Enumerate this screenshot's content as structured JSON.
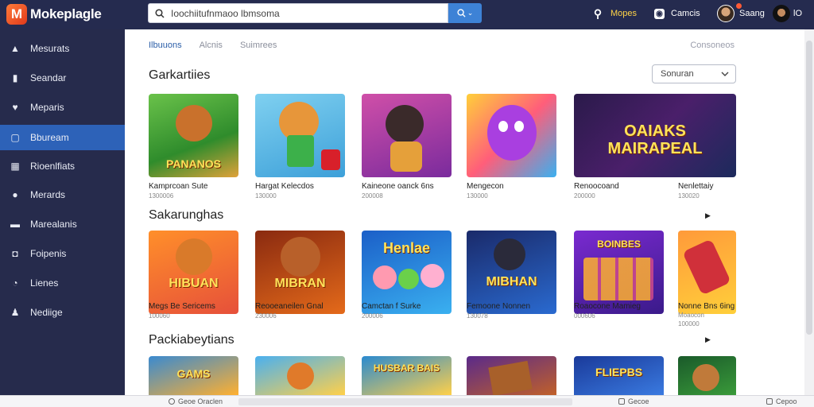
{
  "app": {
    "logo_letter": "M",
    "name": "Mokeplagle"
  },
  "search": {
    "value": "Ioochiitufnmaoo lbmsoma"
  },
  "top_right": {
    "item1": "Mopes",
    "item2": "Camcis",
    "item3": "Saang",
    "item4": "lO"
  },
  "sidebar": {
    "items": [
      {
        "label": "Mesurats",
        "icon": "home-icon"
      },
      {
        "label": "Seandar",
        "icon": "chart-icon"
      },
      {
        "label": "Meparis",
        "icon": "heart-icon"
      },
      {
        "label": "Bbuream",
        "icon": "window-icon",
        "active": true
      },
      {
        "label": "Rioenlfiats",
        "icon": "film-icon"
      },
      {
        "label": "Merards",
        "icon": "location-icon"
      },
      {
        "label": "Marealanis",
        "icon": "image-icon"
      },
      {
        "label": "Foipenis",
        "icon": "folder-icon"
      },
      {
        "label": "Lienes",
        "icon": "search-icon"
      },
      {
        "label": "Nediige",
        "icon": "user-icon"
      }
    ]
  },
  "tabs": [
    "Ilbuuons",
    "Alcnis",
    "Suimrees"
  ],
  "top_link": "Consoneos",
  "sort": {
    "label": "Sonuran"
  },
  "sections": [
    {
      "title": "Garkartiies",
      "cards": [
        {
          "title": "Kamprcoan Sute",
          "meta": "1300006",
          "badge": "PANANOS"
        },
        {
          "title": "Hargat Kelecdos",
          "meta": "130000",
          "badge": ""
        },
        {
          "title": "Kaineone oanck 6ns",
          "meta": "200008",
          "badge": ""
        },
        {
          "title": "Mengecon",
          "meta": "130000",
          "badge": ""
        },
        {
          "title": "Renoocoand",
          "meta": "200000",
          "badge": "OAIAKS MAIRAPEAL"
        },
        {
          "title": "Nenlettaiy",
          "meta": "130020",
          "badge": ""
        }
      ]
    },
    {
      "title": "Sakarunghas",
      "cards": [
        {
          "title": "Megs Be Sericems",
          "meta": "100060",
          "badge": "HIBUAN"
        },
        {
          "title": "Reooeaneilen Gnal",
          "meta": "230006",
          "badge": "MIBRAN"
        },
        {
          "title": "Camctan f Surke",
          "meta": "200006",
          "badge": "Henlae"
        },
        {
          "title": "Femoone Nonnen",
          "meta": "130078",
          "badge": "MIBHAN"
        },
        {
          "title": "Roaocone Mamieg",
          "meta": "000606",
          "badge": "BOINBES"
        },
        {
          "title": "Nonne Bns 6ing",
          "meta": "Moaocon",
          "meta2": "100000",
          "badge": ""
        }
      ]
    },
    {
      "title": "Packiabeytians",
      "cards": [
        {
          "badge": "GAMS"
        },
        {
          "badge": ""
        },
        {
          "badge": "HUSBAR BAIS"
        },
        {
          "badge": ""
        },
        {
          "badge": "FLIEPBS"
        },
        {
          "badge": ""
        }
      ]
    }
  ],
  "status": {
    "left": "Geoe Oraclen",
    "right1": "Gecoe",
    "right2": "Cepoo"
  },
  "colors": {
    "topbar": "#252b4f",
    "sidebar": "#262b4c",
    "active": "#2d62b8",
    "search_button": "#3d82d6"
  }
}
